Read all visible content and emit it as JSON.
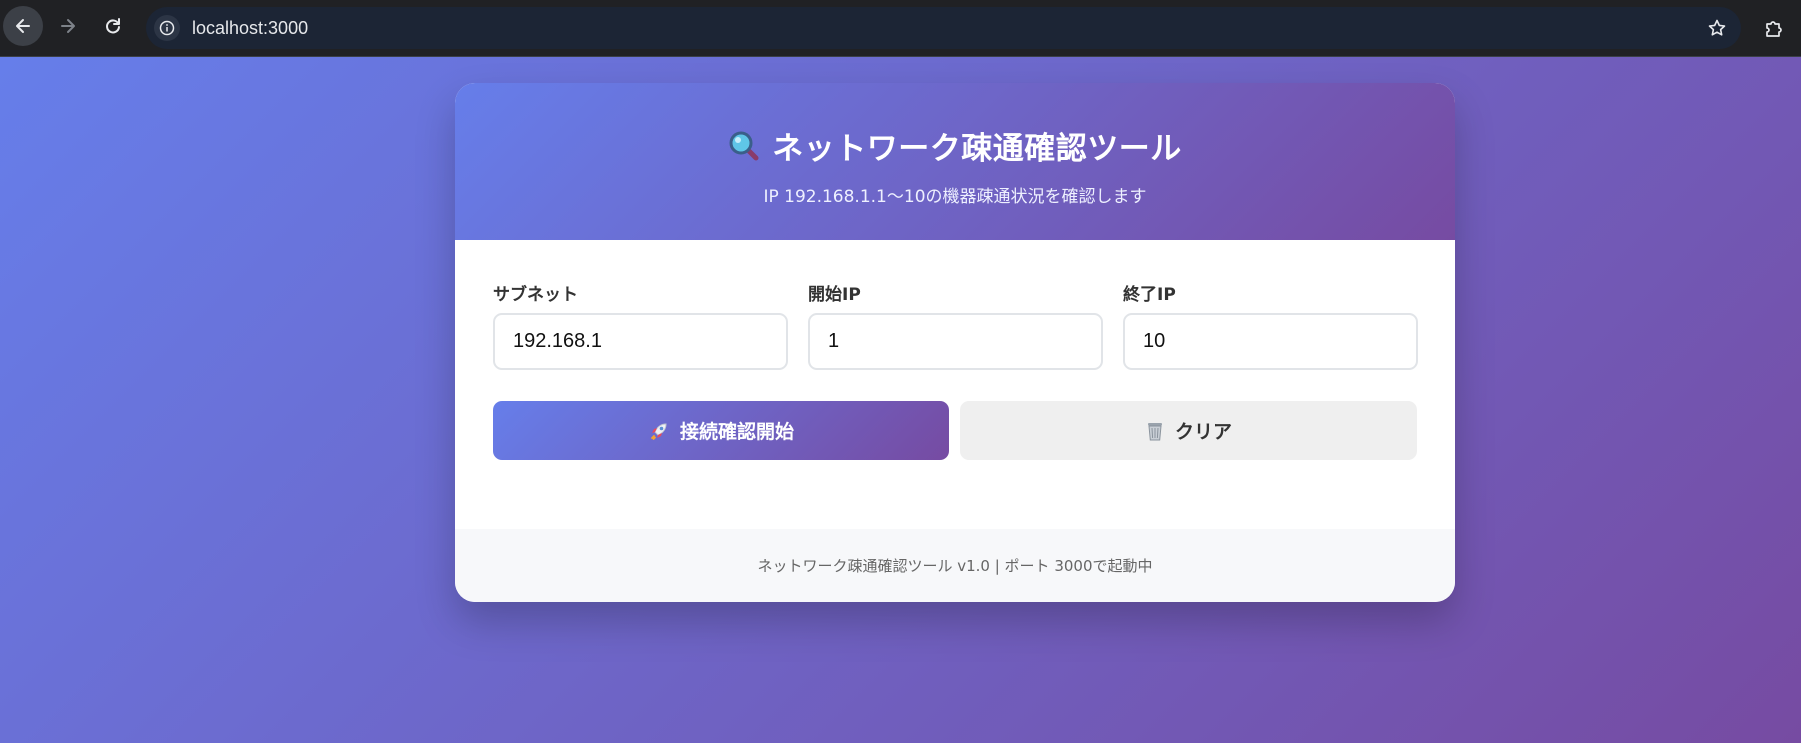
{
  "browser": {
    "url": "localhost:3000"
  },
  "header": {
    "title": "ネットワーク疎通確認ツール",
    "subtitle": "IP 192.168.1.1〜10の機器疎通状況を確認します",
    "icon": "magnifier-icon"
  },
  "form": {
    "subnet_label": "サブネット",
    "subnet_value": "192.168.1",
    "start_ip_label": "開始IP",
    "start_ip_value": "1",
    "end_ip_label": "終了IP",
    "end_ip_value": "10"
  },
  "actions": {
    "start_label": "接続確認開始",
    "start_icon": "rocket-icon",
    "clear_label": "クリア",
    "clear_icon": "wastebasket-icon"
  },
  "footer": {
    "text": "ネットワーク疎通確認ツール v1.0 | ポート 3000で起動中"
  },
  "colors": {
    "gradient_start": "#667eea",
    "gradient_end": "#764ba2",
    "browser_bg": "#202124"
  }
}
